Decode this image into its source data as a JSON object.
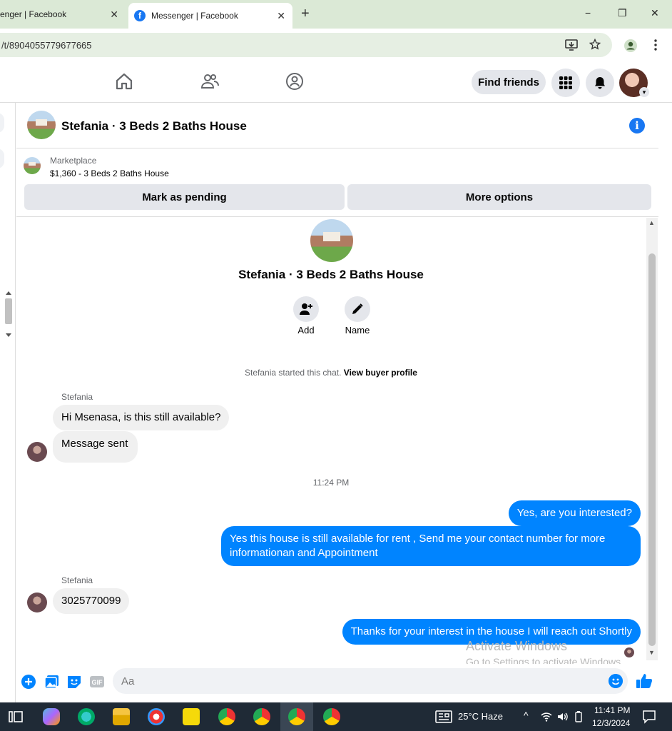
{
  "browser": {
    "tabs": [
      {
        "title": "enger | Facebook",
        "active": false
      },
      {
        "title": "Messenger | Facebook",
        "active": true
      }
    ],
    "new_tab": "+",
    "url": "/t/8904055779677665",
    "window_controls": {
      "minimize": "−",
      "restore": "❐",
      "close": "✕"
    }
  },
  "fbnav": {
    "find_friends": "Find friends"
  },
  "chat": {
    "header_title": "Stefania · 3 Beds 2 Baths House",
    "marketplace_label": "Marketplace",
    "marketplace_listing": "$1,360 - 3 Beds 2 Baths House",
    "mark_pending": "Mark as pending",
    "more_options": "More options",
    "profile_title": "Stefania · 3 Beds 2 Baths House",
    "add_label": "Add",
    "name_label": "Name",
    "system_text": "Stefania started this chat.",
    "system_link": "View buyer profile",
    "time_divider": "11:24 PM",
    "messages": [
      {
        "sender": "Stefania",
        "text": "Hi Msenasa, is this still available?",
        "direction": "in"
      },
      {
        "text": "Message sent",
        "direction": "in"
      },
      {
        "text": "Yes, are you interested?",
        "direction": "out"
      },
      {
        "text": "Yes this house is still available for rent , Send me your contact number for more informationan and Appointment",
        "direction": "out"
      },
      {
        "sender": "Stefania",
        "text": "3025770099",
        "direction": "in"
      },
      {
        "text": "Thanks for your interest in the house I will reach out Shortly",
        "direction": "out"
      }
    ],
    "composer_placeholder": "Aa"
  },
  "watermark": {
    "line1": "Activate Windows",
    "line2": "Go to Settings to activate Windows."
  },
  "taskbar": {
    "weather": "25°C  Haze",
    "time": "11:41 PM",
    "date": "12/3/2024"
  }
}
